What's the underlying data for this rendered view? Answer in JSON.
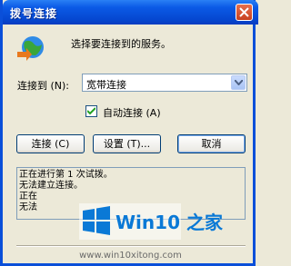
{
  "window": {
    "title": "拨号连接"
  },
  "dialog": {
    "prompt": "选择要连接到的服务。",
    "connect_to_label": "连接到 (N):",
    "connect_to_value": "宽带连接",
    "auto_connect_label": "自动连接 (A)",
    "auto_connect_checked": true
  },
  "buttons": {
    "connect": "连接 (C)",
    "settings": "设置 (T)...",
    "cancel": "取消"
  },
  "log": {
    "lines": [
      "正在进行第 1 次试拨。",
      "无法建立连接。",
      "正在",
      "无法"
    ]
  },
  "watermark": {
    "brand": "Win10 之家",
    "url": "www.win10xitong.com"
  }
}
